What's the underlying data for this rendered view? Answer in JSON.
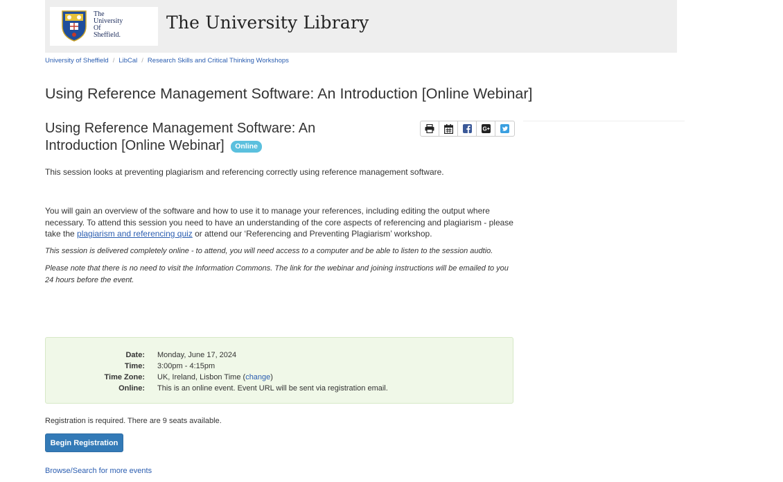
{
  "header": {
    "logo_lines": [
      "The",
      "University",
      "Of",
      "Sheffield."
    ],
    "site_title": "The University Library"
  },
  "breadcrumb": [
    {
      "label": "University of Sheffield"
    },
    {
      "label": "LibCal"
    },
    {
      "label": "Research Skills and Critical Thinking Workshops"
    }
  ],
  "page_title": "Using Reference Management Software: An Introduction [Online Webinar]",
  "event": {
    "title": "Using Reference Management Software: An Introduction [Online Webinar]",
    "badge": "Online",
    "share_icons": [
      "print-icon",
      "calendar-icon",
      "facebook-icon",
      "google-plus-icon",
      "twitter-icon"
    ],
    "desc_intro": "This session looks at preventing plagiarism and referencing correctly using reference management software.",
    "desc_body_pre": "You will gain an overview of the software and how to use it to manage your references, including editing the output where necessary. To attend this session you need to have an understanding of the core aspects of referencing and plagiarism - please take the ",
    "desc_link": "plagiarism and referencing quiz",
    "desc_body_post": " or attend our ‘Referencing and Preventing Plagiarism’ workshop.",
    "note1": "This session is delivered completely online - to attend, you will need access to a computer and be able to listen to the session audtio.",
    "note2": "Please note that there is no need to visit the Information Commons. The link for the webinar and joining instructions will be emailed to you 24 hours before the event."
  },
  "details": {
    "date_label": "Date:",
    "date_value": "Monday, June 17, 2024",
    "time_label": "Time:",
    "time_value": "3:00pm - 4:15pm",
    "tz_label": "Time Zone:",
    "tz_value": "UK, Ireland, Lisbon Time",
    "tz_change": "change",
    "online_label": "Online:",
    "online_value": "This is an online event. Event URL will be sent via registration email."
  },
  "registration": {
    "text": "Registration is required. There are 9 seats available.",
    "button": "Begin Registration"
  },
  "browse_link": "Browse/Search for more events",
  "colors": {
    "header_bg": "#eeeeee",
    "link": "#2a5db0",
    "badge": "#5bc0de",
    "info_bg": "#f0f8e8",
    "button": "#337ab7"
  }
}
